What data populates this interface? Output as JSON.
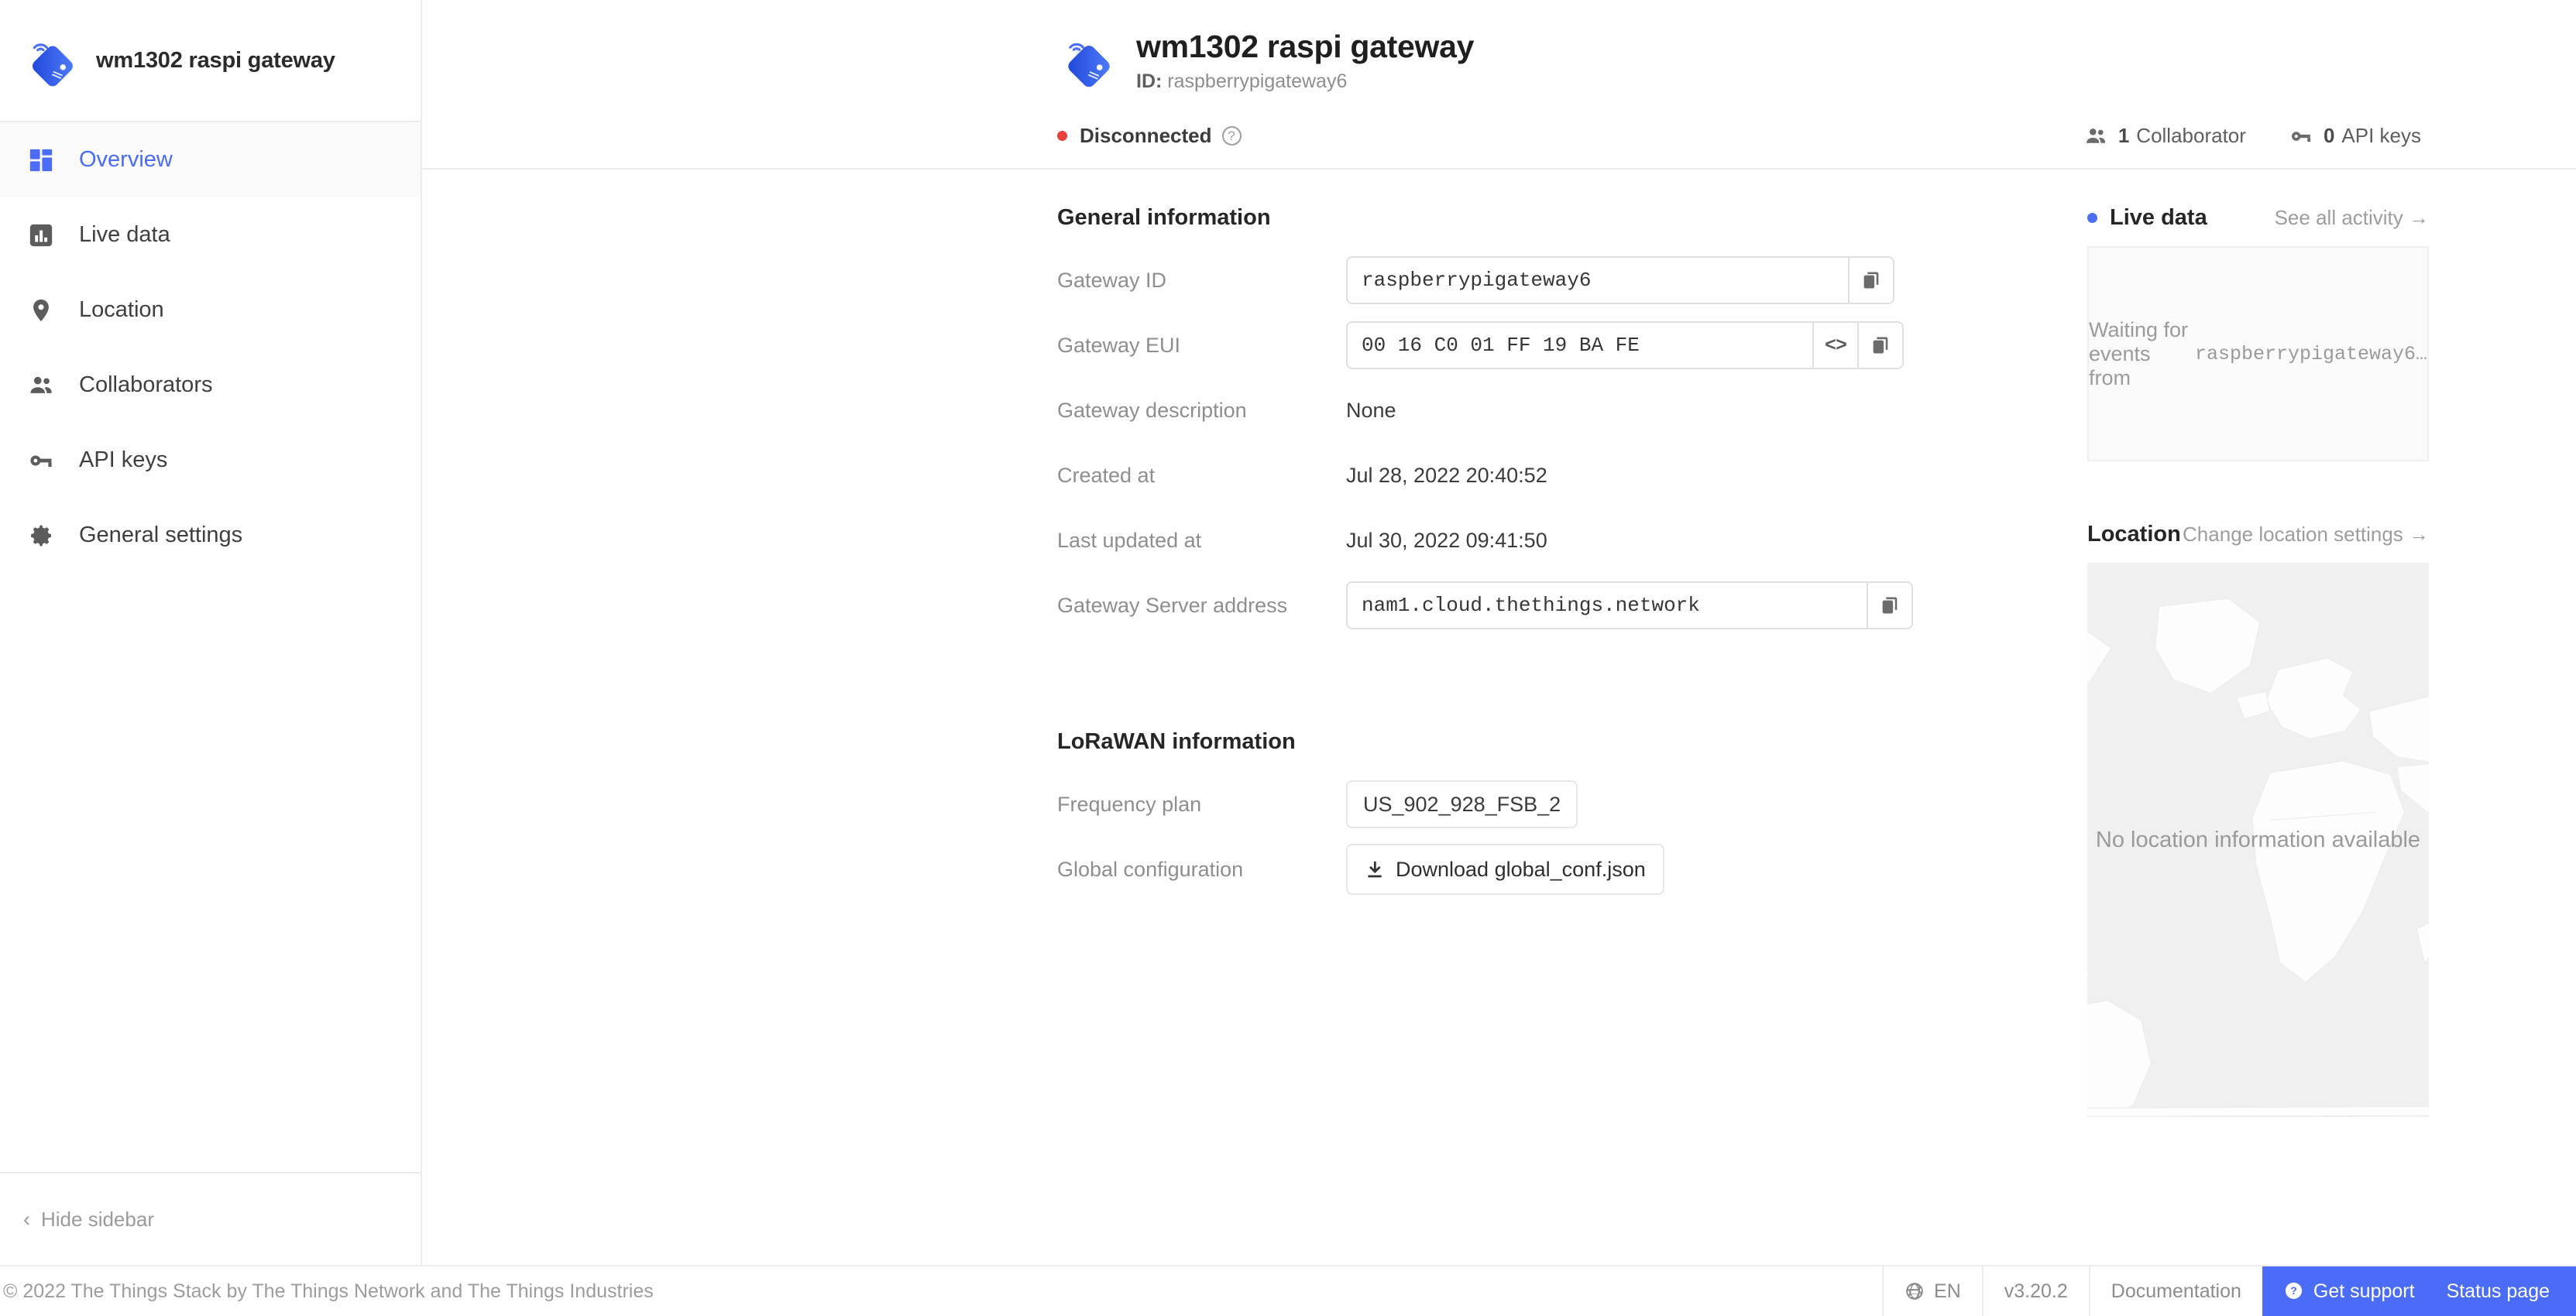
{
  "sidebar": {
    "brand": "wm1302 raspi gateway",
    "brand_icon": "gateway-logo-icon",
    "items": [
      {
        "label": "Overview",
        "icon": "dashboard-grid-icon",
        "active": true
      },
      {
        "label": "Live data",
        "icon": "bar-chart-icon",
        "active": false
      },
      {
        "label": "Location",
        "icon": "map-pin-icon",
        "active": false
      },
      {
        "label": "Collaborators",
        "icon": "people-icon",
        "active": false
      },
      {
        "label": "API keys",
        "icon": "key-icon",
        "active": false
      },
      {
        "label": "General settings",
        "icon": "gear-icon",
        "active": false
      }
    ],
    "hide_sidebar": "Hide sidebar",
    "hide_sidebar_icon": "chevron-left-icon"
  },
  "header": {
    "icon": "gateway-logo-icon",
    "title": "wm1302 raspi gateway",
    "id_label": "ID:",
    "id_value": "raspberrypigateway6",
    "status": "Disconnected",
    "status_help_icon": "question-circle-icon",
    "status_color": "#e8403a",
    "collaborators_icon": "people-icon",
    "collaborators_count": "1",
    "collaborators_label": "Collaborator",
    "apikeys_icon": "key-icon",
    "apikeys_count": "0",
    "apikeys_label": "API keys"
  },
  "general": {
    "section_title": "General information",
    "gateway_id_label": "Gateway ID",
    "gateway_id_value": "raspberrypigateway6",
    "gateway_eui_label": "Gateway EUI",
    "gateway_eui_value": "00 16 C0 01 FF 19 BA FE",
    "eui_code_button": "<>",
    "gateway_description_label": "Gateway description",
    "gateway_description_value": "None",
    "created_at_label": "Created at",
    "created_at_value": "Jul 28, 2022 20:40:52",
    "last_updated_label": "Last updated at",
    "last_updated_value": "Jul 30, 2022 09:41:50",
    "server_address_label": "Gateway Server address",
    "server_address_value": "nam1.cloud.thethings.network",
    "copy_icon": "copy-icon"
  },
  "lorawan": {
    "section_title": "LoRaWAN information",
    "frequency_plan_label": "Frequency plan",
    "frequency_plan_value": "US_902_928_FSB_2",
    "global_config_label": "Global configuration",
    "download_button": "Download global_conf.json",
    "download_icon": "download-icon"
  },
  "live_data": {
    "title": "Live data",
    "dot_color": "#4a6cf7",
    "link": "See all activity →",
    "waiting_prefix": "Waiting for events from",
    "waiting_target": "raspberrypigateway6…"
  },
  "location": {
    "title": "Location",
    "link": "Change location settings →",
    "empty_message": "No location information available"
  },
  "footer": {
    "copyright": "© 2022 The Things Stack by The Things Network and The Things Industries",
    "language_icon": "globe-icon",
    "language": "EN",
    "version": "v3.20.2",
    "documentation": "Documentation",
    "support_icon": "question-circle-filled-icon",
    "support": "Get support",
    "status_page": "Status page",
    "accent_color": "#4a6cf7"
  }
}
